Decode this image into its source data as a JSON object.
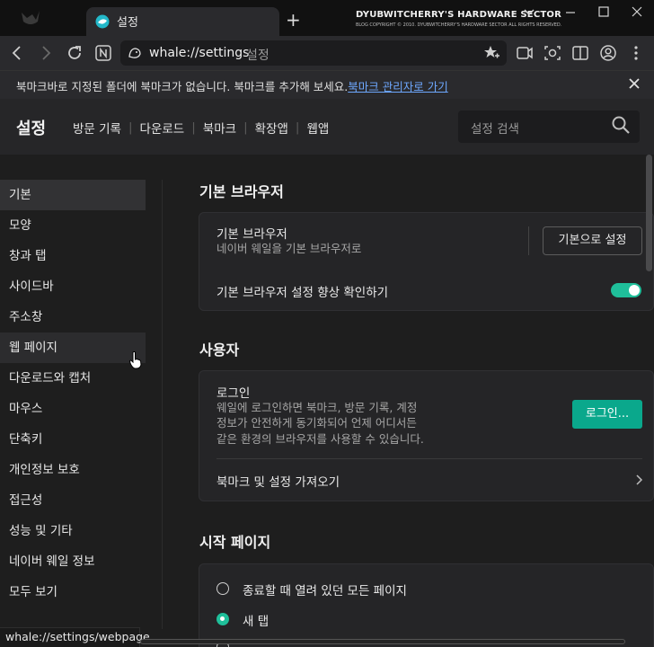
{
  "browser": {
    "tab_title": "설정",
    "new_tab_glyph": "+",
    "banner_title": "DYUBWITCHERRY'S HARDWARE SECTOR",
    "banner_sub": "BLOG COPYRIGHT © 2010. DYUBWITCHERRY'S HARDWARE SECTOR ALL RIGHTS RESERVED.",
    "url": "whale://settings",
    "url_suffix": "설정",
    "status_url": "whale://settings/webpage"
  },
  "bookmark_bar": {
    "message": "북마크바로 지정된 폴더에 북마크가 없습니다. 북마크를 추가해 보세요.",
    "link": "북마크 관리자로 가기"
  },
  "settings_header": {
    "title": "설정",
    "nav": [
      "방문 기록",
      "다운로드",
      "북마크",
      "확장앱",
      "웹앱"
    ],
    "search_placeholder": "설정 검색"
  },
  "sidebar": {
    "items": [
      "기본",
      "모양",
      "창과 탭",
      "사이드바",
      "주소창",
      "웹 페이지",
      "다운로드와 캡처",
      "마우스",
      "단축키",
      "개인정보 보호",
      "접근성",
      "성능 및 기타",
      "네이버 웨일 정보",
      "모두 보기"
    ],
    "active_index": 0,
    "hover_index": 5
  },
  "sections": {
    "default_browser": {
      "title": "기본 브라우저",
      "row1_label": "기본 브라우저",
      "row1_desc": "네이버 웨일을 기본 브라우저로",
      "row1_button": "기본으로 설정",
      "row2_label": "기본 브라우저 설정 향상 확인하기",
      "row2_enabled": true
    },
    "user": {
      "title": "사용자",
      "login_label": "로그인",
      "login_desc": [
        "웨일에 로그인하면 북마크, 방문 기록, 계정",
        "정보가 안전하게 동기화되어 언제 어디서든",
        "같은 환경의 브라우저를 사용할 수 있습니다."
      ],
      "login_button": "로그인...",
      "import_label": "북마크 및 설정 가져오기"
    },
    "startup": {
      "title": "시작 페이지",
      "options": [
        "종료할 때 열려 있던 모든 페이지",
        "새 탭"
      ],
      "selected_index": 1
    }
  },
  "colors": {
    "accent": "#1fbf9a",
    "button_green": "#0aa88c",
    "link": "#6ea8ff"
  }
}
